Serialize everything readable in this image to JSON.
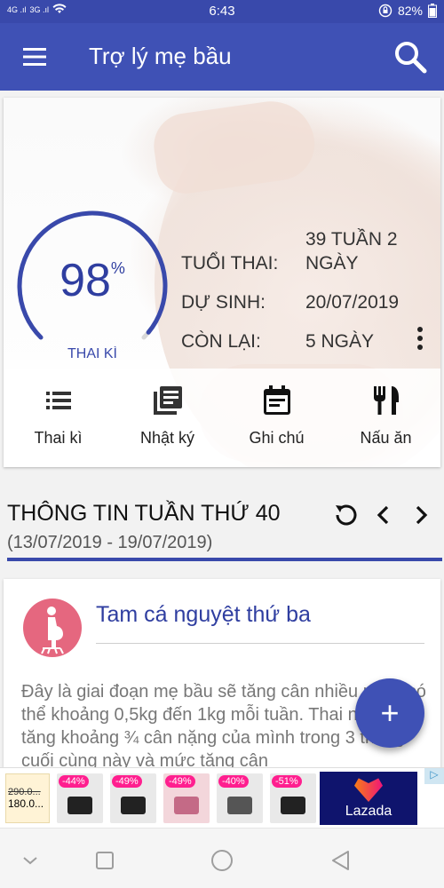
{
  "status": {
    "signal_left": "4G .ıl",
    "signal_right": "3G .ıl",
    "time": "6:43",
    "battery": "82%"
  },
  "appbar": {
    "title": "Trợ lý mẹ bầu",
    "menu_icon": "menu-icon",
    "search_icon": "search-icon"
  },
  "pregnancy": {
    "progress_percent": 98,
    "percent_sign": "%",
    "progress_label": "THAI KÌ",
    "age_label": "TUỔI THAI:",
    "age_value": "39 TUẦN 2 NGÀY",
    "due_label": "DỰ SINH:",
    "due_value": "20/07/2019",
    "remain_label": "CÒN LẠI:",
    "remain_value": "5 NGÀY"
  },
  "actions": [
    {
      "label": "Thai kì",
      "icon": "list-icon"
    },
    {
      "label": "Nhật ký",
      "icon": "library-books-icon"
    },
    {
      "label": "Ghi chú",
      "icon": "event-note-icon"
    },
    {
      "label": "Nấu ăn",
      "icon": "restaurant-icon"
    }
  ],
  "week": {
    "title": "THÔNG TIN TUẦN THỨ 40",
    "range": "(13/07/2019 - 19/07/2019)"
  },
  "card": {
    "title": "Tam cá nguyệt thứ ba",
    "body": "Đây là giai đoạn mẹ bầu sẽ tăng cân nhiều nhất, có thể khoảng 0,5kg đến 1kg mỗi tuần. Thai nhi sẽ tăng khoảng ¾ cân nặng của mình trong 3 tháng cuối cùng này và mức tăng cân"
  },
  "fab": {
    "label": "+"
  },
  "ad": {
    "old_price": "290.0...",
    "new_price": "180.0...",
    "discounts": [
      "-44%",
      "-49%",
      "-49%",
      "-40%",
      "-51%"
    ],
    "brand": "Lazada",
    "choice": "▷"
  },
  "colors": {
    "primary": "#3f51b5",
    "primary_dark": "#3949ab",
    "accent_pink": "#e5677f"
  }
}
